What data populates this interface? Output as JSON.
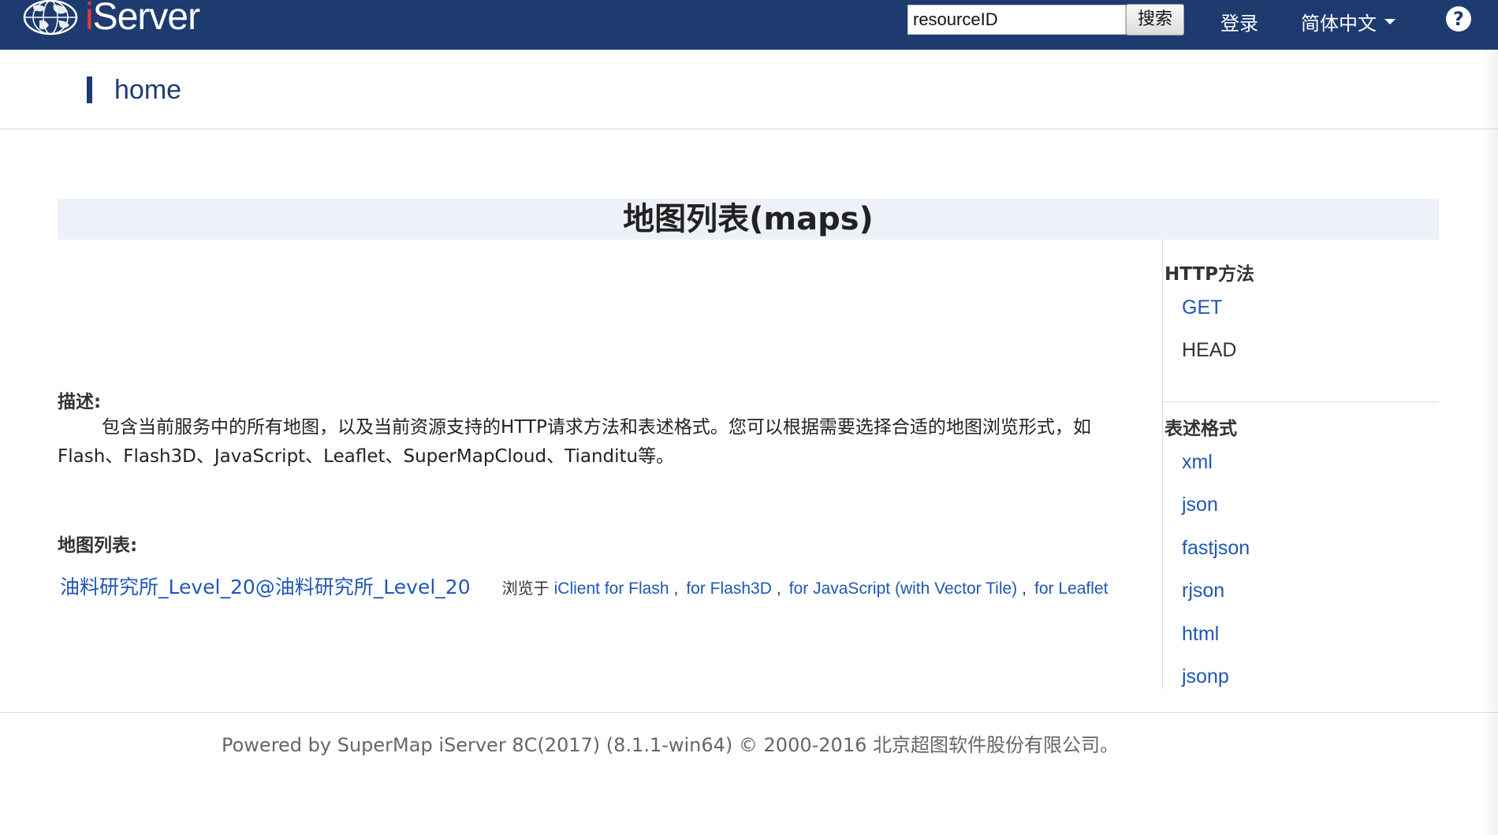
{
  "header": {
    "brand": "Server",
    "brand_prefix": "i",
    "search_value": "resourceID",
    "search_button": "搜索",
    "login": "登录",
    "language": "简体中文",
    "help": "?"
  },
  "breadcrumb": {
    "current": "home"
  },
  "page": {
    "title": "地图列表(maps)"
  },
  "sidebar": {
    "http_heading": "HTTP方法",
    "http_methods": [
      "GET",
      "HEAD"
    ],
    "format_heading": "表述格式",
    "formats": [
      "xml",
      "json",
      "fastjson",
      "rjson",
      "html",
      "jsonp"
    ]
  },
  "content": {
    "desc_label": "描述:",
    "description": "包含当前服务中的所有地图，以及当前资源支持的HTTP请求方法和表述格式。您可以根据需要选择合适的地图浏览形式，如Flash、Flash3D、JavaScript、Leaflet、SuperMapCloud、Tianditu等。",
    "maps_label": "地图列表:",
    "map_name": "油料研究所_Level_20@油料研究所_Level_20",
    "browse_prefix": "浏览于",
    "browse_links": [
      "iClient for Flash",
      "for Flash3D",
      "for JavaScript (with Vector Tile)",
      "for Leaflet"
    ]
  },
  "footer": {
    "text": "Powered by SuperMap iServer 8C(2017) (8.1.1-win64) © 2000-2016 北京超图软件股份有限公司。"
  },
  "colors": {
    "header_bg": "#1e3b6f",
    "link": "#1f57b5",
    "title_band": "#eef2f8"
  }
}
